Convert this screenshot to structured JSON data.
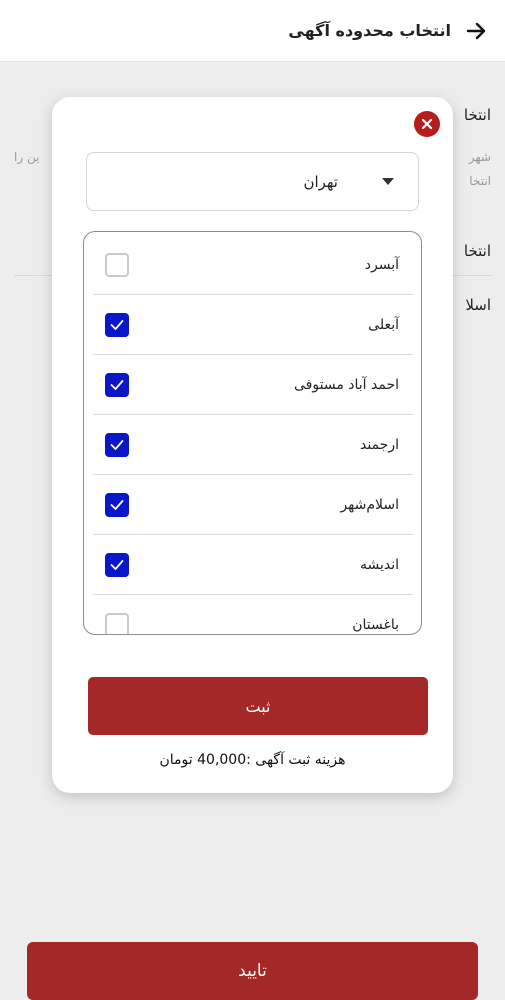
{
  "header": {
    "title": "انتخاب محدوده آگهی"
  },
  "background": {
    "section1_title": "انتخا",
    "section1_sub_right": "شهر",
    "section1_sub_left": "ین را",
    "section1_sub2": "انتخا",
    "section2_title": "انتخا",
    "section3_title": "اسلا",
    "confirm_label": "تایید"
  },
  "modal": {
    "city_select": {
      "value": "تهران"
    },
    "districts": [
      {
        "label": "آبسرد",
        "checked": false
      },
      {
        "label": "آبعلی",
        "checked": true
      },
      {
        "label": "احمد آباد مستوفی",
        "checked": true
      },
      {
        "label": "ارجمند",
        "checked": true
      },
      {
        "label": "اسلام‌شهر",
        "checked": true
      },
      {
        "label": "اندیشه",
        "checked": true
      },
      {
        "label": "باغستان",
        "checked": false
      }
    ],
    "submit_label": "ثبت",
    "cost_text": "هزینه ثبت آگهی :40,000 تومان"
  },
  "colors": {
    "primary": "#a42828",
    "checkbox": "#0b16c8",
    "close": "#b71c1c"
  }
}
